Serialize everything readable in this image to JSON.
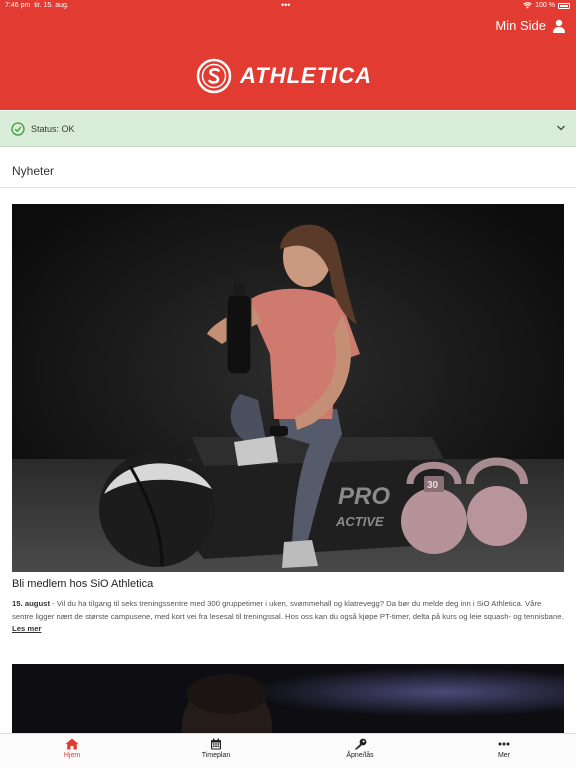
{
  "statusbar": {
    "time": "7:46 pm",
    "date": "tir. 15. aug.",
    "battery": "100 %"
  },
  "header": {
    "min_side_label": "Min Side",
    "logo_text": "ATHLETICA",
    "background": "#e23b32"
  },
  "status": {
    "label": "Status: OK",
    "color": "#d8ecd8"
  },
  "news": {
    "section_title": "Nyheter",
    "items": [
      {
        "title": "Bli medlem hos SiO Athletica",
        "date": "15. august",
        "text": " - Vil du ha tilgang til seks treningssentre med 300 gruppetimer i uken, svømmehall og klatrevegg? Da bør du melde deg inn i SiO Athletica. Våre sentre ligger nært de største campusene, med kort vei fra lesesal til treningssal. Hos oss kan du også kjøpe PT-timer, delta på kurs og leie squash- og tennisbane. ",
        "read_more": "Les mer",
        "image_text_1": "PRO",
        "image_text_2": "ACTIVE",
        "image_text_3": "30"
      }
    ]
  },
  "tabs": [
    {
      "label": "Hjem",
      "icon": "home-icon",
      "active": true
    },
    {
      "label": "Timeplan",
      "icon": "calendar-icon",
      "active": false
    },
    {
      "label": "Åpne/lås",
      "icon": "key-icon",
      "active": false
    },
    {
      "label": "Mer",
      "icon": "more-icon",
      "active": false
    }
  ]
}
